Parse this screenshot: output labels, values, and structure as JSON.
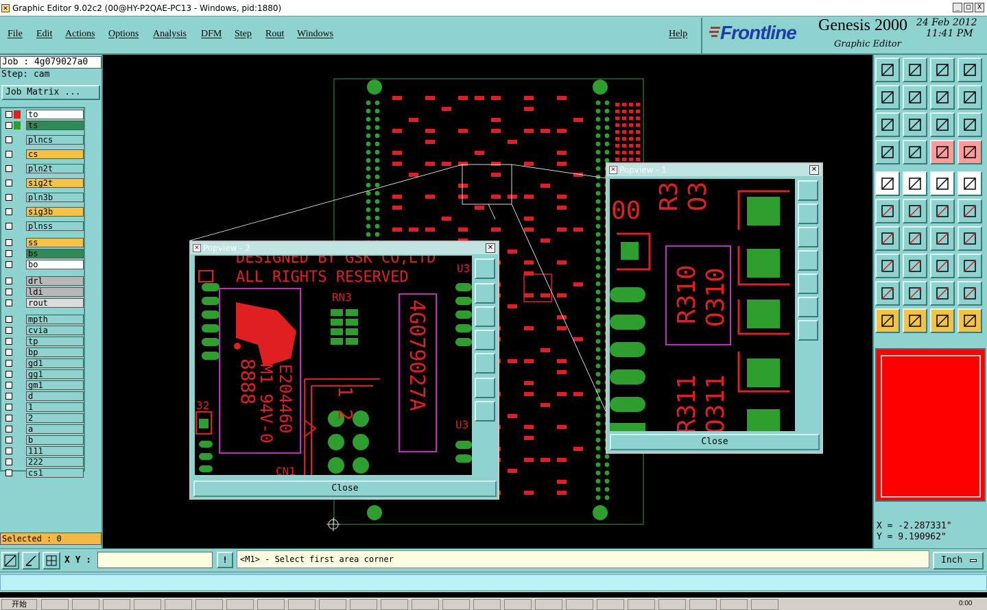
{
  "window": {
    "title": "Graphic Editor 9.02c2 (00@HY-P2QAE-PC13 - Windows, pid:1880)",
    "buttons": [
      "_",
      "□",
      "X"
    ]
  },
  "menu": [
    "File",
    "Edit",
    "Actions",
    "Options",
    "Analysis",
    "DFM",
    "Step",
    "Rout",
    "Windows"
  ],
  "help_label": "Help",
  "brand": {
    "logo": "Frontline",
    "product": "Genesis 2000",
    "date": "24 Feb 2012",
    "time": "11:41 PM",
    "subtitle": "Graphic Editor"
  },
  "left": {
    "job_label": "Job : 4g079027a0",
    "step_label": "Step: cam",
    "job_matrix_button": "Job Matrix ...",
    "layers": [
      {
        "name": "to",
        "bg": "#ffffff"
      },
      {
        "name": "ts",
        "bg": "#2e8b57"
      },
      {
        "name": "plncs",
        "bg": "#8fd3d0"
      },
      {
        "name": "cs",
        "bg": "#f4c244"
      },
      {
        "name": "pln2t",
        "bg": "#8fd3d0"
      },
      {
        "name": "sig2t",
        "bg": "#f4c244"
      },
      {
        "name": "pln3b",
        "bg": "#8fd3d0"
      },
      {
        "name": "sig3b",
        "bg": "#f4c244"
      },
      {
        "name": "plnss",
        "bg": "#8fd3d0"
      },
      {
        "name": "ss",
        "bg": "#f4c244"
      },
      {
        "name": "bs",
        "bg": "#2e8b57"
      },
      {
        "name": "bo",
        "bg": "#ffffff"
      },
      {
        "name": "drl",
        "bg": "#b8b8b8"
      },
      {
        "name": "ldi",
        "bg": "#b8b8b8"
      },
      {
        "name": "rout",
        "bg": "#dcdcdc"
      },
      {
        "name": "mpth",
        "bg": "#8fd3d0"
      },
      {
        "name": "cvia",
        "bg": "#8fd3d0"
      },
      {
        "name": "tp",
        "bg": "#8fd3d0"
      },
      {
        "name": "bp",
        "bg": "#8fd3d0"
      },
      {
        "name": "gd1",
        "bg": "#8fd3d0"
      },
      {
        "name": "gg1",
        "bg": "#8fd3d0"
      },
      {
        "name": "gm1",
        "bg": "#8fd3d0"
      },
      {
        "name": "d",
        "bg": "#8fd3d0"
      },
      {
        "name": "1",
        "bg": "#8fd3d0"
      },
      {
        "name": "2",
        "bg": "#8fd3d0"
      },
      {
        "name": "a",
        "bg": "#8fd3d0"
      },
      {
        "name": "b",
        "bg": "#8fd3d0"
      },
      {
        "name": "111",
        "bg": "#8fd3d0"
      },
      {
        "name": "222",
        "bg": "#8fd3d0"
      },
      {
        "name": "cs1",
        "bg": "#8fd3d0"
      }
    ],
    "selected_label": "Selected : 0"
  },
  "popup2": {
    "title": "Popview - 2",
    "texts": {
      "t1": "DESIGNED BY GSK CO,LTD",
      "t2": "ALL RIGHTS RESERVED",
      "rn3": "RN3",
      "u3a": "U3",
      "u3b": "U3",
      "part": "4G079027A",
      "ul1": "E204460",
      "ul2": "M1 94V-0",
      "ul3": "8888",
      "n12": "1 2",
      "n32": "32",
      "cn1": "CN1"
    },
    "close_label": "Close"
  },
  "popup1": {
    "title": "Popview - 1",
    "texts": {
      "oo": "00",
      "r3": "R3",
      "o3": "O3",
      "r310": "R310",
      "o310": "O310",
      "r311": "R311",
      "o311": "O311"
    },
    "close_label": "Close"
  },
  "coords": {
    "x": "X = -2.287331\"",
    "y": "Y = 9.190962\""
  },
  "cmd": {
    "xy_label": "X Y :",
    "xy_value": "",
    "message": "<M1> - Select first area corner",
    "units": "Inch"
  },
  "taskbar": {
    "start": "开始",
    "time": "0:00"
  },
  "colors": {
    "panel": "#8fd3d0",
    "copper": "#e02020",
    "pad": "#2e9e2e",
    "silk": "#c030c0"
  }
}
